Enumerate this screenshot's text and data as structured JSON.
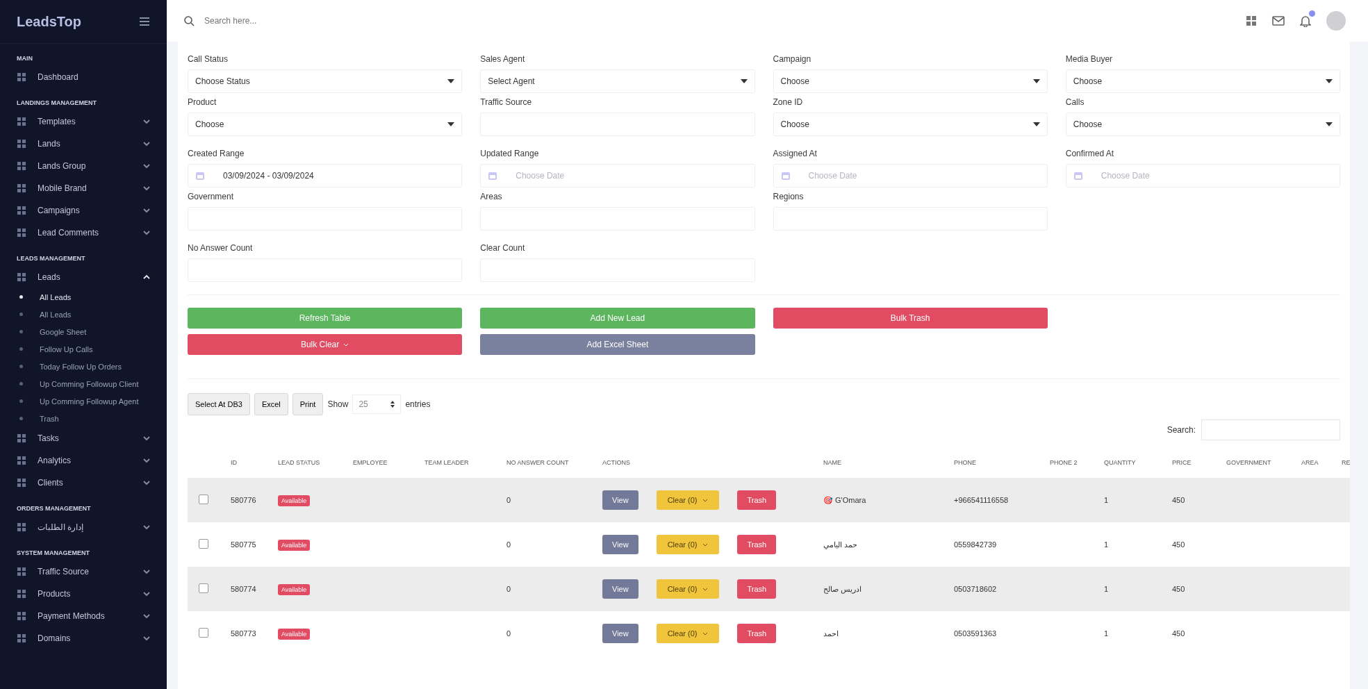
{
  "sidebar": {
    "logo": "LeadsTop",
    "sections": [
      {
        "title": "MAIN",
        "items": [
          {
            "label": "Dashboard",
            "kind": "link"
          }
        ]
      },
      {
        "title": "LANDINGS MANAGEMENT",
        "items": [
          {
            "label": "Templates",
            "kind": "group",
            "expanded": false
          },
          {
            "label": "Lands",
            "kind": "group",
            "expanded": false
          },
          {
            "label": "Lands Group",
            "kind": "group",
            "expanded": false
          },
          {
            "label": "Mobile Brand",
            "kind": "group",
            "expanded": false
          },
          {
            "label": "Campaigns",
            "kind": "group",
            "expanded": false
          },
          {
            "label": "Lead Comments",
            "kind": "group",
            "expanded": false
          }
        ]
      },
      {
        "title": "LEADS MANAGEMENT",
        "items": [
          {
            "label": "Leads",
            "kind": "group",
            "expanded": true,
            "children": [
              {
                "label": "All Leads",
                "selected": true
              },
              {
                "label": "All Leads",
                "selected": false
              },
              {
                "label": "Google Sheet",
                "selected": false
              },
              {
                "label": "Follow Up Calls",
                "selected": false
              },
              {
                "label": "Today Follow Up Orders",
                "selected": false
              },
              {
                "label": "Up Comming Followup Client",
                "selected": false
              },
              {
                "label": "Up Comming Followup Agent",
                "selected": false
              },
              {
                "label": "Trash",
                "selected": false
              }
            ]
          },
          {
            "label": "Tasks",
            "kind": "group",
            "expanded": false
          },
          {
            "label": "Analytics",
            "kind": "group",
            "expanded": false
          },
          {
            "label": "Clients",
            "kind": "group",
            "expanded": false
          }
        ]
      },
      {
        "title": "ORDERS MANAGEMENT",
        "items": [
          {
            "label": "إدارة الطلبات",
            "kind": "group",
            "expanded": false
          }
        ]
      },
      {
        "title": "SYSTEM MANAGEMENT",
        "items": [
          {
            "label": "Traffic Source",
            "kind": "group",
            "expanded": false
          },
          {
            "label": "Products",
            "kind": "group",
            "expanded": false
          },
          {
            "label": "Payment Methods",
            "kind": "group",
            "expanded": false
          },
          {
            "label": "Domains",
            "kind": "group",
            "expanded": false
          }
        ]
      }
    ]
  },
  "topbar": {
    "search": {
      "placeholder": "Search here..."
    },
    "notification_badge": true
  },
  "filter_rows": [
    [
      {
        "label": "Call Status",
        "kind": "select",
        "value": "Choose Status"
      },
      {
        "label": "Sales Agent",
        "kind": "select",
        "value": "Select Agent"
      },
      {
        "label": "Campaign",
        "kind": "select",
        "value": "Choose"
      },
      {
        "label": "Media Buyer",
        "kind": "select",
        "value": "Choose"
      }
    ],
    [
      {
        "label": "Product",
        "kind": "select",
        "value": "Choose"
      },
      {
        "label": "Traffic Source",
        "kind": "text"
      },
      {
        "label": "Zone ID",
        "kind": "select",
        "value": "Choose"
      },
      {
        "label": "Calls",
        "kind": "select",
        "value": "Choose"
      }
    ],
    [
      {
        "label": "Created Range",
        "kind": "date",
        "value": "03/09/2024 - 03/09/2024"
      },
      {
        "label": "Updated Range",
        "kind": "date",
        "placeholder": "Choose Date"
      },
      {
        "label": "Assigned At",
        "kind": "date",
        "placeholder": "Choose Date"
      },
      {
        "label": "Confirmed At",
        "kind": "date",
        "placeholder": "Choose Date"
      }
    ],
    [
      {
        "label": "Government",
        "kind": "text"
      },
      {
        "label": "Areas",
        "kind": "text"
      },
      {
        "label": "Regions",
        "kind": "text"
      }
    ],
    [
      {
        "label": "No Answer Count",
        "kind": "text"
      },
      {
        "label": "Clear Count",
        "kind": "text"
      }
    ]
  ],
  "action_buttons": [
    [
      {
        "label": "Refresh Table",
        "kind": "success",
        "caret": false
      },
      {
        "label": "Add New Lead",
        "kind": "success",
        "caret": false
      },
      {
        "label": "Bulk Trash",
        "kind": "danger",
        "caret": false
      }
    ],
    [
      {
        "label": "Bulk Clear",
        "kind": "danger",
        "caret": true
      },
      {
        "label": "Add Excel Sheet",
        "kind": "secondary",
        "caret": false
      }
    ]
  ],
  "table_tools": {
    "buttons": [
      "Select At DB3",
      "Excel",
      "Print"
    ],
    "show_label": "Show",
    "page_size": "25",
    "entries_label": "entries",
    "search_label": "Search:"
  },
  "table": {
    "columns": [
      "ID",
      "LEAD STATUS",
      "EMPLOYEE",
      "TEAM LEADER",
      "NO ANSWER COUNT",
      "ACTIONS",
      "NAME",
      "PHONE",
      "PHONE 2",
      "QUANTITY",
      "PRICE",
      "GOVERNMENT",
      "AREA",
      "RE"
    ],
    "rows": [
      {
        "checked": false,
        "id": "580776",
        "status": "Available",
        "no_answer_count": "0",
        "view": "View",
        "clear": "Clear (0)",
        "trash": "Trash",
        "name": "🎯 G'Omara",
        "phone": "+966541116558",
        "quantity": "1",
        "price": "450"
      },
      {
        "checked": false,
        "id": "580775",
        "status": "Available",
        "no_answer_count": "0",
        "view": "View",
        "clear": "Clear (0)",
        "trash": "Trash",
        "name": "حمد اليامي",
        "phone": "0559842739",
        "quantity": "1",
        "price": "450"
      },
      {
        "checked": false,
        "id": "580774",
        "status": "Available",
        "no_answer_count": "0",
        "view": "View",
        "clear": "Clear (0)",
        "trash": "Trash",
        "name": "ادريس صالح",
        "phone": "0503718602",
        "quantity": "1",
        "price": "450"
      },
      {
        "checked": false,
        "id": "580773",
        "status": "Available",
        "no_answer_count": "0",
        "view": "View",
        "clear": "Clear (0)",
        "trash": "Trash",
        "name": "احمد",
        "phone": "0503591363",
        "quantity": "1",
        "price": "450"
      }
    ]
  }
}
